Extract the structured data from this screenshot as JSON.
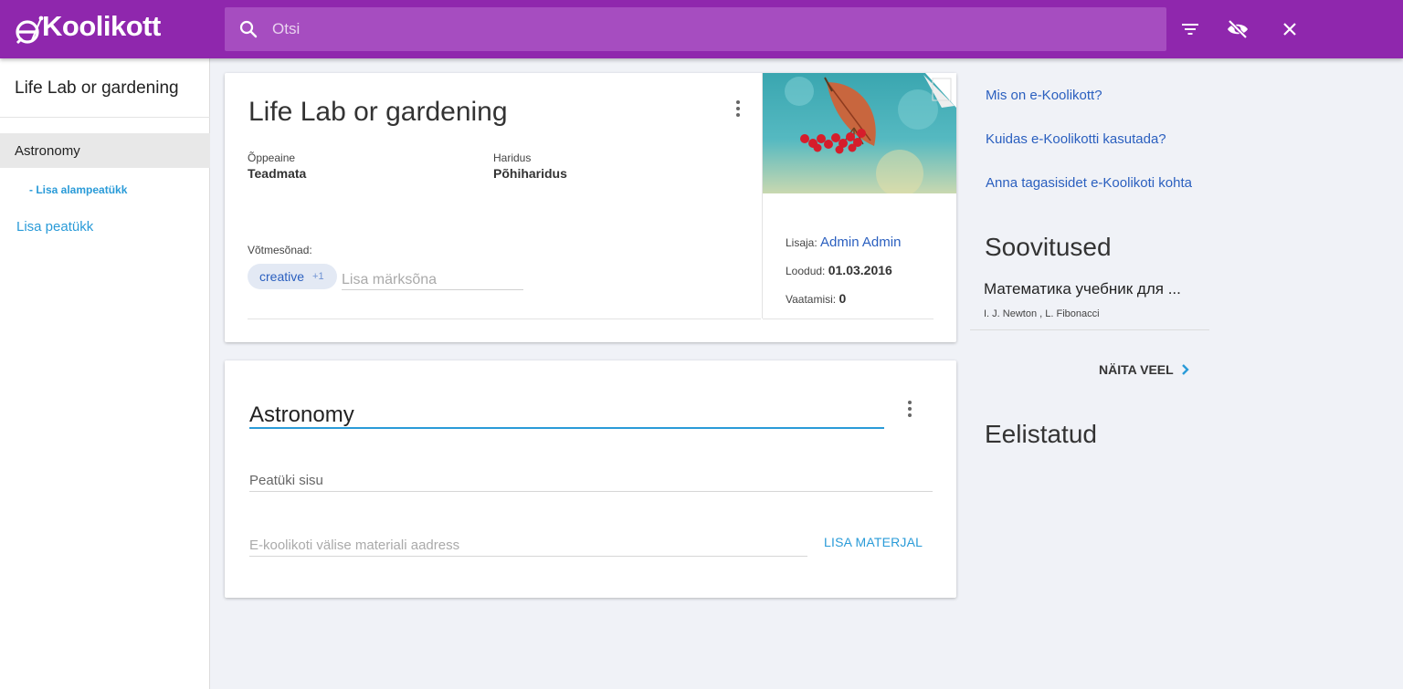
{
  "header": {
    "logo_text": "Koolikott",
    "search_placeholder": "Otsi",
    "icons": [
      "search-icon",
      "filter-icon",
      "eye-off-icon",
      "close-icon"
    ],
    "background_color": "#8f27ad"
  },
  "sidebar": {
    "title": "Life Lab or gardening",
    "active_chapter": "Astronomy",
    "add_subchapter": "- Lisa alampeatükk",
    "add_chapter": "Lisa peatükk"
  },
  "material": {
    "title": "Life Lab or gardening",
    "subject_label": "Õppeaine",
    "subject_value": "Teadmata",
    "education_label": "Haridus",
    "education_value": "Põhiharidus",
    "keywords_label": "Võtmesõnad:",
    "keyword_chip": "creative",
    "keyword_more": "+1",
    "keyword_placeholder": "Lisa märksõna",
    "author_label": "Lisaja:",
    "author_value": "Admin Admin",
    "created_label": "Loodud:",
    "created_value": "01.03.2016",
    "views_label": "Vaatamisi:",
    "views_value": "0"
  },
  "chapter": {
    "title_value": "Astronomy",
    "content_placeholder": "Peatüki sisu",
    "url_placeholder": "E-koolikoti välise materiali aadress",
    "add_material": "LISA MATERJAL"
  },
  "right": {
    "links": [
      "Mis on e-Koolikott?",
      "Kuidas e-Koolikotti kasutada?",
      "Anna tagasisidet e-Koolikoti kohta"
    ],
    "recommendations_heading": "Soovitused",
    "rec_title": "Математика учебник для ...",
    "rec_authors": "I. J. Newton , L. Fibonacci",
    "show_more": "NÄITA VEEL",
    "favorites_heading": "Eelistatud"
  },
  "colors": {
    "accent_blue": "#2a9bd8",
    "link_blue": "#2a5fbf"
  }
}
